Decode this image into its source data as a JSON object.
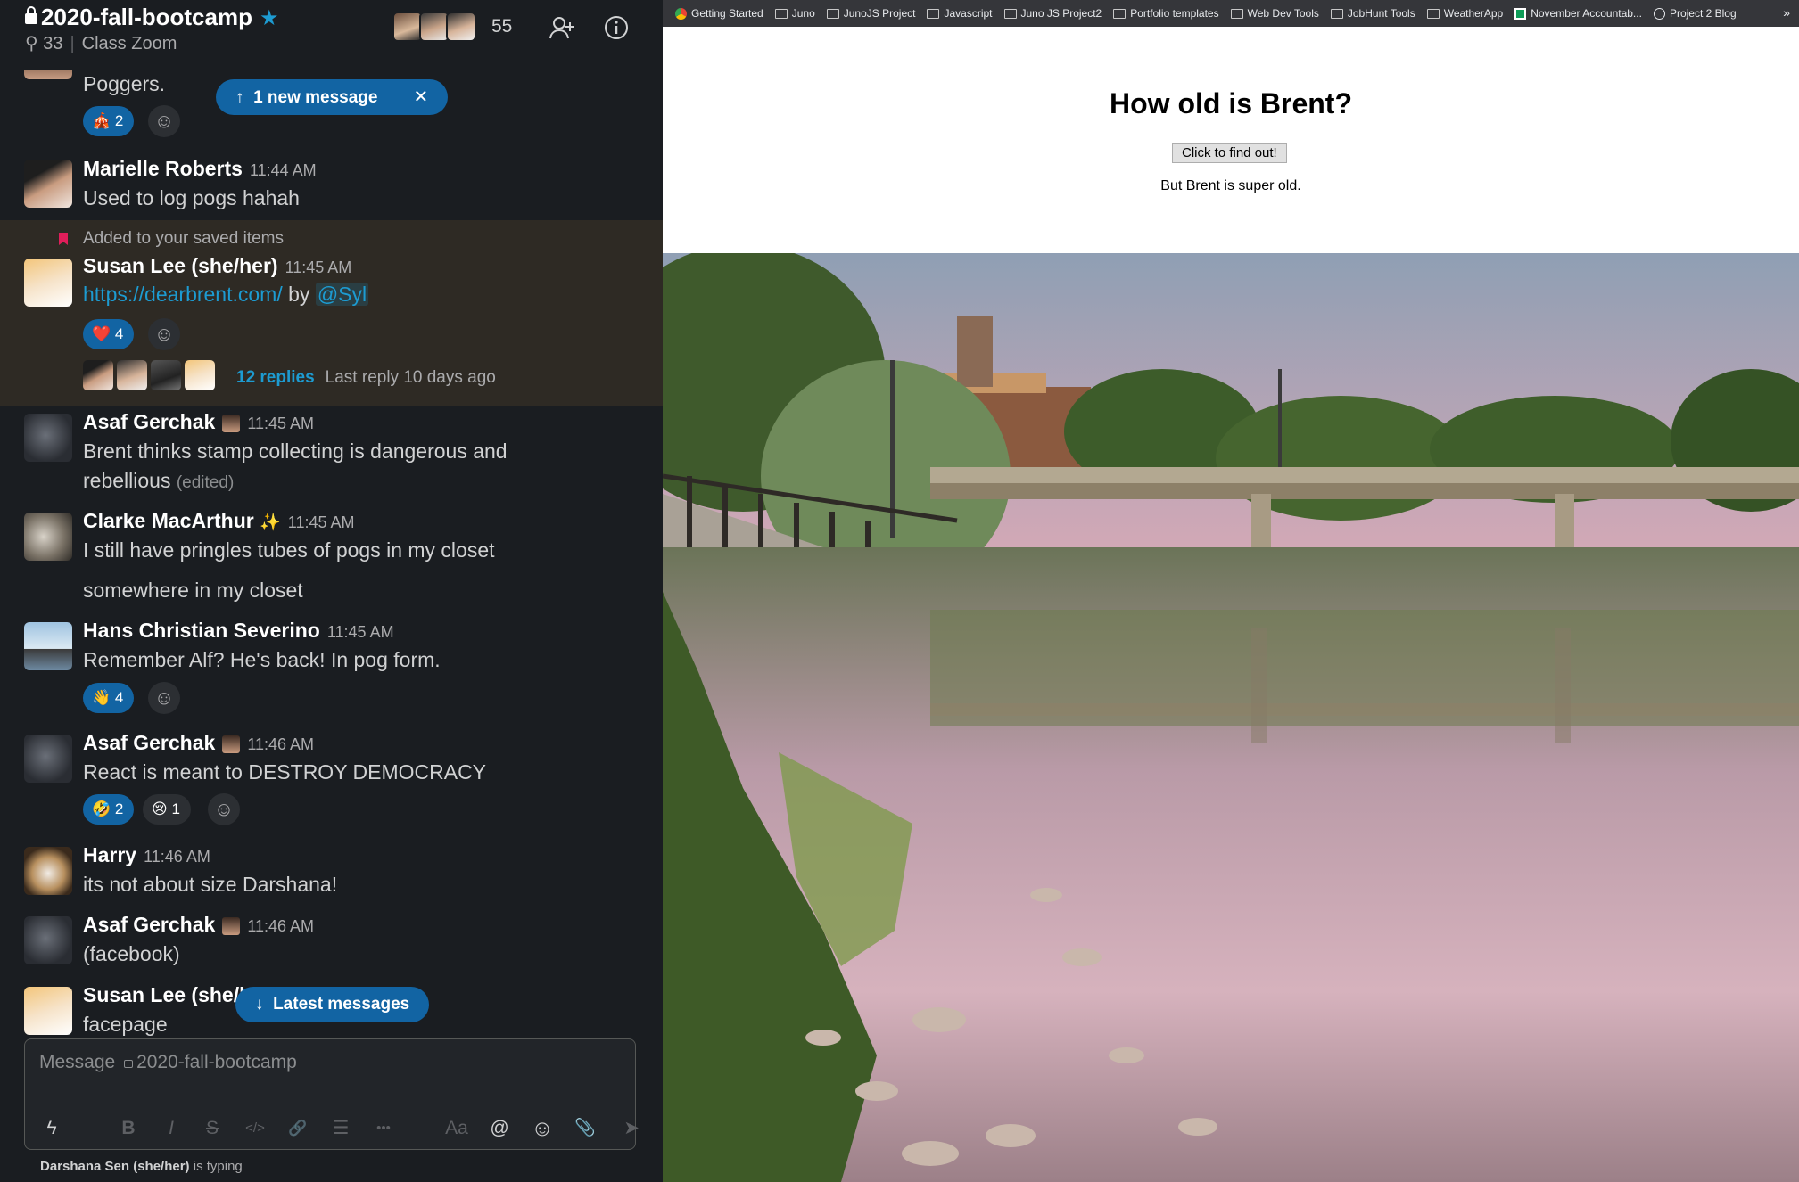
{
  "slack": {
    "channel": {
      "name": "2020-fall-bootcamp",
      "pins": "33",
      "topic": "Class Zoom",
      "member_count": "55"
    },
    "new_message_pill": {
      "label": "1 new message",
      "close": "✕"
    },
    "latest_pill": {
      "label": "Latest messages"
    },
    "saved_label": "Added to your saved items",
    "messages": [
      {
        "body": "Poggers.",
        "reactions": [
          {
            "emoji": "🎪",
            "count": "2"
          }
        ]
      },
      {
        "author": "Marielle Roberts",
        "time": "11:44 AM",
        "body": "Used to log pogs hahah"
      },
      {
        "author": "Susan Lee (she/her)",
        "time": "11:45 AM",
        "link": "https://dearbrent.com/",
        "by": "by",
        "mention": "@Syl",
        "reactions": [
          {
            "emoji": "❤️",
            "count": "4"
          }
        ],
        "thread": {
          "replies": "12 replies",
          "last_reply": "Last reply 10 days ago"
        }
      },
      {
        "author": "Asaf Gerchak",
        "time": "11:45 AM",
        "body": "Brent thinks stamp collecting is dangerous and",
        "body2": "rebellious",
        "edited": "(edited)"
      },
      {
        "author": "Clarke MacArthur",
        "badge": "✨",
        "time": "11:45 AM",
        "body": "I still have pringles tubes of pogs in my closet",
        "body2": "somewhere in my closet"
      },
      {
        "author": "Hans Christian Severino",
        "time": "11:45 AM",
        "body": "Remember Alf? He's back! In pog form.",
        "reactions": [
          {
            "emoji": "👋",
            "count": "4"
          }
        ]
      },
      {
        "author": "Asaf Gerchak",
        "time": "11:46 AM",
        "body": "React is meant to DESTROY DEMOCRACY",
        "reactions": [
          {
            "emoji": "🤣",
            "count": "2"
          },
          {
            "emoji": "😢",
            "count": "1"
          }
        ]
      },
      {
        "author": "Harry",
        "time": "11:46 AM",
        "body": "its not about size Darshana!"
      },
      {
        "author": "Asaf Gerchak",
        "time": "11:46 AM",
        "body": "(facebook)"
      },
      {
        "author": "Susan Lee (she/h",
        "body": "facepage"
      }
    ],
    "composer": {
      "placeholder_prefix": "Message",
      "placeholder_channel": "2020-fall-bootcamp"
    },
    "toolbar": {
      "bold": "B",
      "italic": "I",
      "strike": "S",
      "code": "</>",
      "link": "🔗",
      "list": "☰",
      "more": "•••",
      "format": "Aa",
      "at": "@",
      "emoji": "☺",
      "attach": "📎",
      "send": "➤"
    },
    "typing": {
      "who": "Darshana Sen (she/her)",
      "text": " is typing"
    }
  },
  "browser": {
    "bookmarks": [
      "Getting Started",
      "Juno",
      "JunoJS Project",
      "Javascript",
      "Juno JS Project2",
      "Portfolio templates",
      "Web Dev Tools",
      "JobHunt Tools",
      "WeatherApp",
      "November Accountab...",
      "Project 2 Blog"
    ],
    "more": "»",
    "page": {
      "title": "How old is Brent?",
      "button": "Click to find out!",
      "result": "But Brent is super old."
    }
  },
  "colors": {
    "slack_bg": "#1a1d21",
    "accent": "#1264a3",
    "link": "#1d9bd1",
    "saved_bg": "#2e2a24",
    "bookmark_bar": "#35363a"
  }
}
